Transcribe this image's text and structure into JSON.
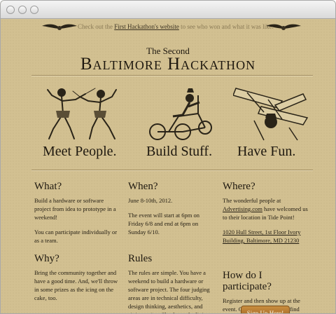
{
  "top_bar": {
    "msg_prefix": "Check out the",
    "msg_link": "First Hackathon's website",
    "msg_suffix": "to see who won and what it was like."
  },
  "header": {
    "subtitle": "The Second",
    "title": "Baltimore Hackathon"
  },
  "taglines": [
    "Meet People.",
    "Build Stuff.",
    "Have Fun."
  ],
  "what": {
    "heading": "What?",
    "p1": "Build a hardware or software project from idea to prototype in a weekend!",
    "p2": "You can participate individually or as a team."
  },
  "when": {
    "heading": "When?",
    "p1": "June 8-10th, 2012.",
    "p2": "The event will start at 6pm on Friday 6/8 and end at 6pm on Sunday 6/10."
  },
  "where": {
    "heading": "Where?",
    "p1_prefix": "The wonderful people at",
    "p1_link": "Advertising.com",
    "p1_suffix": "have welcomed us to their location in Tide Point!",
    "address": "1020 Hull Street, 1st Floor Ivory Building, Baltimore, MD 21230"
  },
  "why": {
    "heading": "Why?",
    "p1": "Bring the community together and have a good time. And, we'll throw in some prizes as the icing on the cake, too."
  },
  "rules": {
    "heading": "Rules",
    "p1": "The rules are simple. You have a weekend to build a hardware or software project. The four judging areas are in technical difficulty, design thinking, aesthetics, and civic service. Check out the living"
  },
  "how": {
    "heading": "How do I participate?",
    "p1": "Register and then show up at the event. Come with a team or find one when you get there.",
    "button": "Sign Up Here!"
  },
  "colors": {
    "background": "#d2c091",
    "text": "#231d12",
    "button": "#b57a31"
  }
}
